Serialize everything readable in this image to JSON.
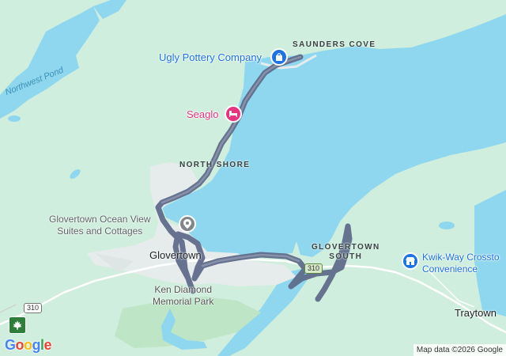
{
  "map": {
    "places": {
      "saunders_cove": "SAUNDERS COVE",
      "ugly_pottery": "Ugly Pottery Company",
      "seaglo": "Seaglo",
      "north_shore": "NORTH SHORE",
      "ocean_view": "Glovertown Ocean View\nSuites and Cottages",
      "glovertown": "Glovertown",
      "glovertown_south": "GLOVERTOWN\nSOUTH",
      "ken_diamond": "Ken Diamond\nMemorial Park",
      "kwik_way": "Kwik-Way Crossto\nConvenience",
      "traytown": "Traytown",
      "northwest_pond": "Northwest Pond"
    },
    "routes": {
      "route_310_a": "310",
      "route_310_b": "310"
    },
    "icons": {
      "shopping": "shopping-bag-icon",
      "hotel": "bed-icon",
      "store": "storefront-icon",
      "location": "location-pin-icon",
      "highway": "maple-leaf-shield-icon"
    },
    "colors": {
      "water": "#8fd7ef",
      "land": "#cfeedd",
      "urban": "#e6ecec",
      "park": "#bde5c6",
      "route": "#5f6b8a",
      "shopping_pin": "#1a73e8",
      "hotel_pin": "#e8337e",
      "location_pin": "#80868b"
    },
    "attribution": "Map data ©2026 Google",
    "logo": "Google"
  }
}
